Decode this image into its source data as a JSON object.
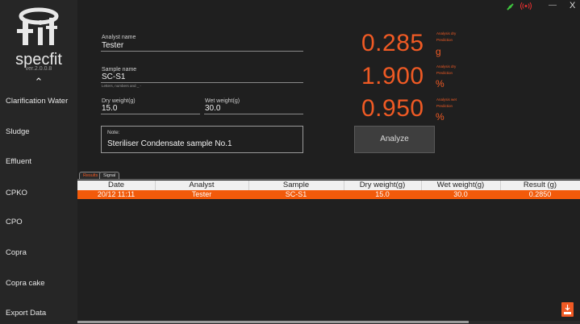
{
  "app": {
    "logo_text": "specfit",
    "version": "ver.2.0.0.8",
    "collapse_icon": "chevron-up-icon"
  },
  "sidebar": {
    "items": [
      {
        "label": "Clarification Water"
      },
      {
        "label": "Sludge"
      },
      {
        "label": "Effluent"
      },
      {
        "label": "CPKO"
      },
      {
        "label": "CPO"
      },
      {
        "label": "Copra"
      },
      {
        "label": "Copra cake"
      },
      {
        "label": "Export Data"
      }
    ]
  },
  "window": {
    "icons": [
      "plug-connected-icon",
      "broadcast-icon"
    ],
    "minimize": "—",
    "close": "X"
  },
  "form": {
    "analyst": {
      "label": "Analyst name",
      "value": "Tester"
    },
    "sample": {
      "label": "Sample name",
      "value": "SC-S1",
      "hint": "Letters, numbers and _ -"
    },
    "dry_weight": {
      "label": "Dry weight(g)",
      "value": "15.0"
    },
    "wet_weight": {
      "label": "Wet weight(g)",
      "value": "30.0"
    },
    "note": {
      "label": "Note:",
      "value": "Steriliser Condensate sample No.1"
    }
  },
  "results_display": [
    {
      "value": "0.285",
      "unit": "g",
      "tag": "Analysis dry",
      "sub": "Prediction"
    },
    {
      "value": "1.900",
      "unit": "%",
      "tag": "Analysis dry",
      "sub": "Prediction"
    },
    {
      "value": "0.950",
      "unit": "%",
      "tag": "Analysis wet",
      "sub": "Prediction"
    }
  ],
  "analyze_button": "Analyze",
  "tabs": [
    {
      "label": "Results",
      "active": true
    },
    {
      "label": "Signal",
      "active": false
    }
  ],
  "table": {
    "columns": [
      "Date",
      "Analyst",
      "Sample",
      "Dry weight(g)",
      "Wet weight(g)",
      "Result (g)"
    ],
    "rows": [
      [
        "20/12 11:11",
        "Tester",
        "SC-S1",
        "15.0",
        "30.0",
        "0.2850"
      ]
    ]
  },
  "colors": {
    "accent": "#f05a24",
    "selected_row": "#f25a0a",
    "background": "#1f1f1f",
    "sidebar": "#262626"
  },
  "export_icon": "pdf-download-icon"
}
